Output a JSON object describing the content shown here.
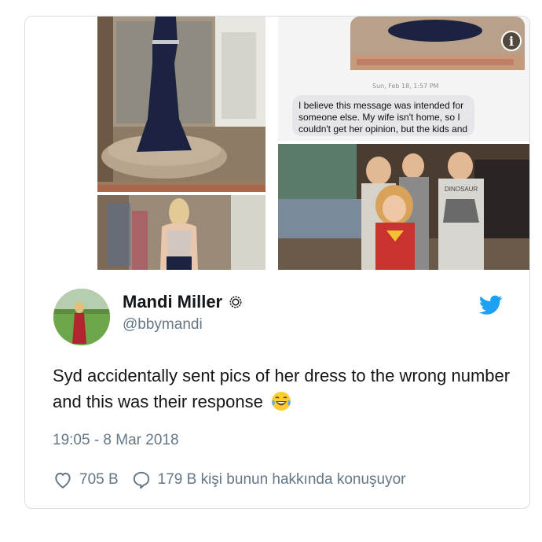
{
  "tweet": {
    "author_name": "Mandi Miller",
    "handle": "@bbymandi",
    "text": "Syd accidentally sent pics of her dress to the wrong number and this was their response",
    "timestamp": "19:05 - 8 Mar 2018",
    "likes": "705 B",
    "replies_text": "179 B kişi bunun hakkında konuşuyor"
  },
  "media": {
    "sms_date": "Sun, Feb 18, 1:57 PM",
    "sms_message": "I believe this message was intended for someone else. My wife isn't home, so I couldn't get her opinion, but the kids and I think you look",
    "shirt_text": "DINOSAUR",
    "info_label": "i"
  },
  "colors": {
    "brand": "#1da1f2",
    "secondary_text": "#657786",
    "border": "#d6dde3"
  },
  "icons": [
    "info-icon",
    "verified-icon",
    "twitter-bird-icon",
    "laughing-emoji-icon",
    "heart-icon",
    "reply-bubble-icon"
  ]
}
